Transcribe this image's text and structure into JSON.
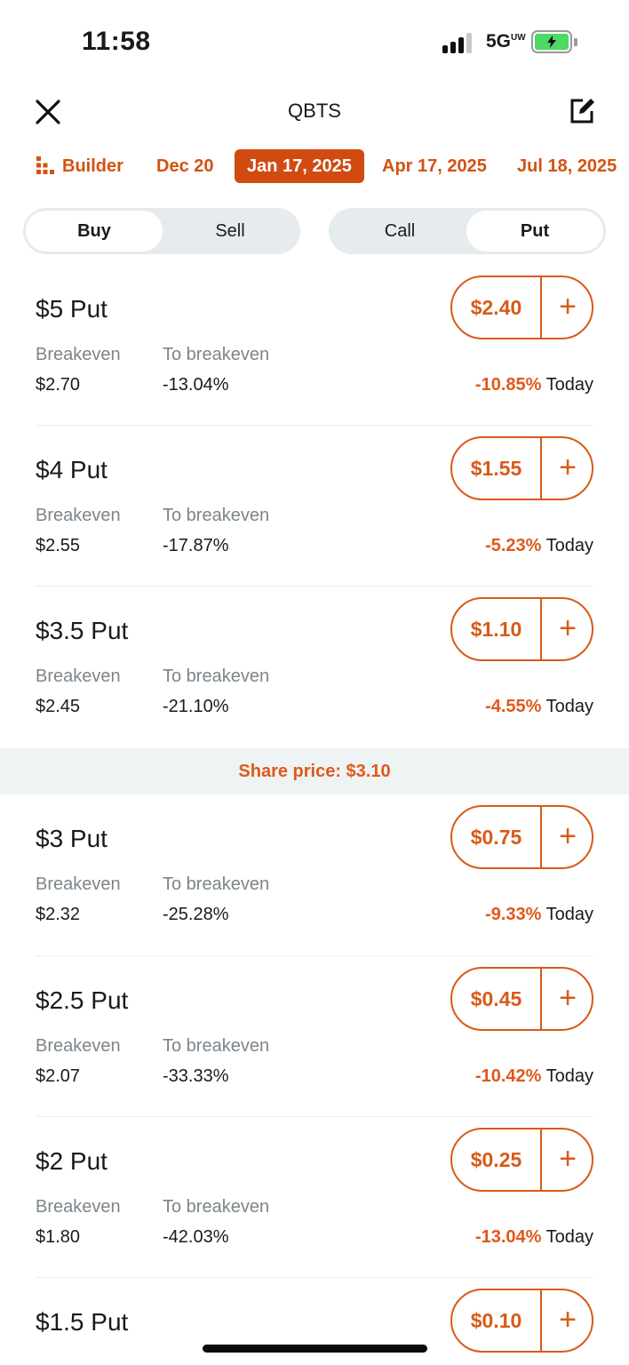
{
  "status_bar": {
    "time": "11:58",
    "network": "5G",
    "network_sup": "UW"
  },
  "header": {
    "title": "QBTS",
    "close_icon": "close-icon",
    "edit_icon": "edit-icon"
  },
  "chips": {
    "builder": "Builder",
    "dates": [
      "Dec 20",
      "Jan 17, 2025",
      "Apr 17, 2025",
      "Jul 18, 2025"
    ],
    "active": "Jan 17, 2025"
  },
  "toggles": {
    "side": {
      "buy": "Buy",
      "sell": "Sell",
      "selected": "Buy"
    },
    "type": {
      "call": "Call",
      "put": "Put",
      "selected": "Put"
    }
  },
  "labels": {
    "breakeven": "Breakeven",
    "to_breakeven": "To breakeven",
    "today": "Today"
  },
  "share_price": "Share price: $3.10",
  "options": [
    {
      "strike": "$5 Put",
      "breakeven": "$2.70",
      "to_breakeven": "-13.04%",
      "price": "$2.40",
      "change": "-10.85%"
    },
    {
      "strike": "$4 Put",
      "breakeven": "$2.55",
      "to_breakeven": "-17.87%",
      "price": "$1.55",
      "change": "-5.23%"
    },
    {
      "strike": "$3.5 Put",
      "breakeven": "$2.45",
      "to_breakeven": "-21.10%",
      "price": "$1.10",
      "change": "-4.55%"
    },
    {
      "strike": "$3 Put",
      "breakeven": "$2.32",
      "to_breakeven": "-25.28%",
      "price": "$0.75",
      "change": "-9.33%"
    },
    {
      "strike": "$2.5 Put",
      "breakeven": "$2.07",
      "to_breakeven": "-33.33%",
      "price": "$0.45",
      "change": "-10.42%"
    },
    {
      "strike": "$2 Put",
      "breakeven": "$1.80",
      "to_breakeven": "-42.03%",
      "price": "$0.25",
      "change": "-13.04%"
    },
    {
      "strike": "$1.5 Put",
      "price": "$0.10"
    }
  ],
  "colors": {
    "accent": "#d85a17",
    "active_chip": "#d14a10",
    "change": "#e0591a",
    "muted": "#7c858b"
  }
}
